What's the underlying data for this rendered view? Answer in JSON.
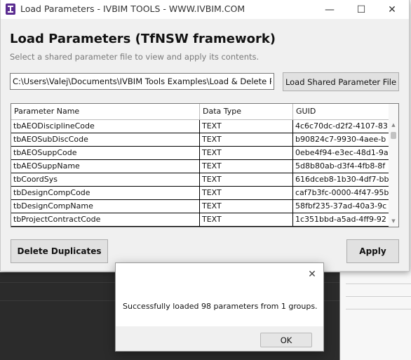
{
  "window": {
    "title": "Load Parameters - IVBIM TOOLS - WWW.IVBIM.COM",
    "minimize": "—",
    "maximize": "☐",
    "close": "✕"
  },
  "header": {
    "title": "Load Parameters (TfNSW framework)",
    "subtitle": "Select a shared parameter file to view and apply its contents."
  },
  "file": {
    "path": "C:\\Users\\Valej\\Documents\\IVBIM Tools Examples\\Load & Delete Param",
    "load_button": "Load Shared Parameter File"
  },
  "grid": {
    "columns": [
      "Parameter Name",
      "Data Type",
      "GUID"
    ],
    "rows": [
      [
        "tbAEODisciplineCode",
        "TEXT",
        "4c6c70dc-d2f2-4107-83"
      ],
      [
        "tbAEOSubDiscCode",
        "TEXT",
        "b90824c7-9930-4aee-b"
      ],
      [
        "tbAEOSuppCode",
        "TEXT",
        "0ebe4f94-e3ec-48d1-9a"
      ],
      [
        "tbAEOSuppName",
        "TEXT",
        "5d8b80ab-d3f4-4fb8-8f"
      ],
      [
        "tbCoordSys",
        "TEXT",
        "616dceb8-1b30-4df7-bb"
      ],
      [
        "tbDesignCompCode",
        "TEXT",
        "caf7b3fc-0000-4f47-95b"
      ],
      [
        "tbDesignCompName",
        "TEXT",
        "58fbf235-37ad-40a3-9c"
      ],
      [
        "tbProjectContractCode",
        "TEXT",
        "1c351bbd-a5ad-4ff9-92"
      ]
    ]
  },
  "actions": {
    "delete_duplicates": "Delete Duplicates",
    "apply": "Apply"
  },
  "dialog": {
    "message": "Successfully loaded 98 parameters from 1 groups.",
    "ok": "OK",
    "close": "✕"
  }
}
